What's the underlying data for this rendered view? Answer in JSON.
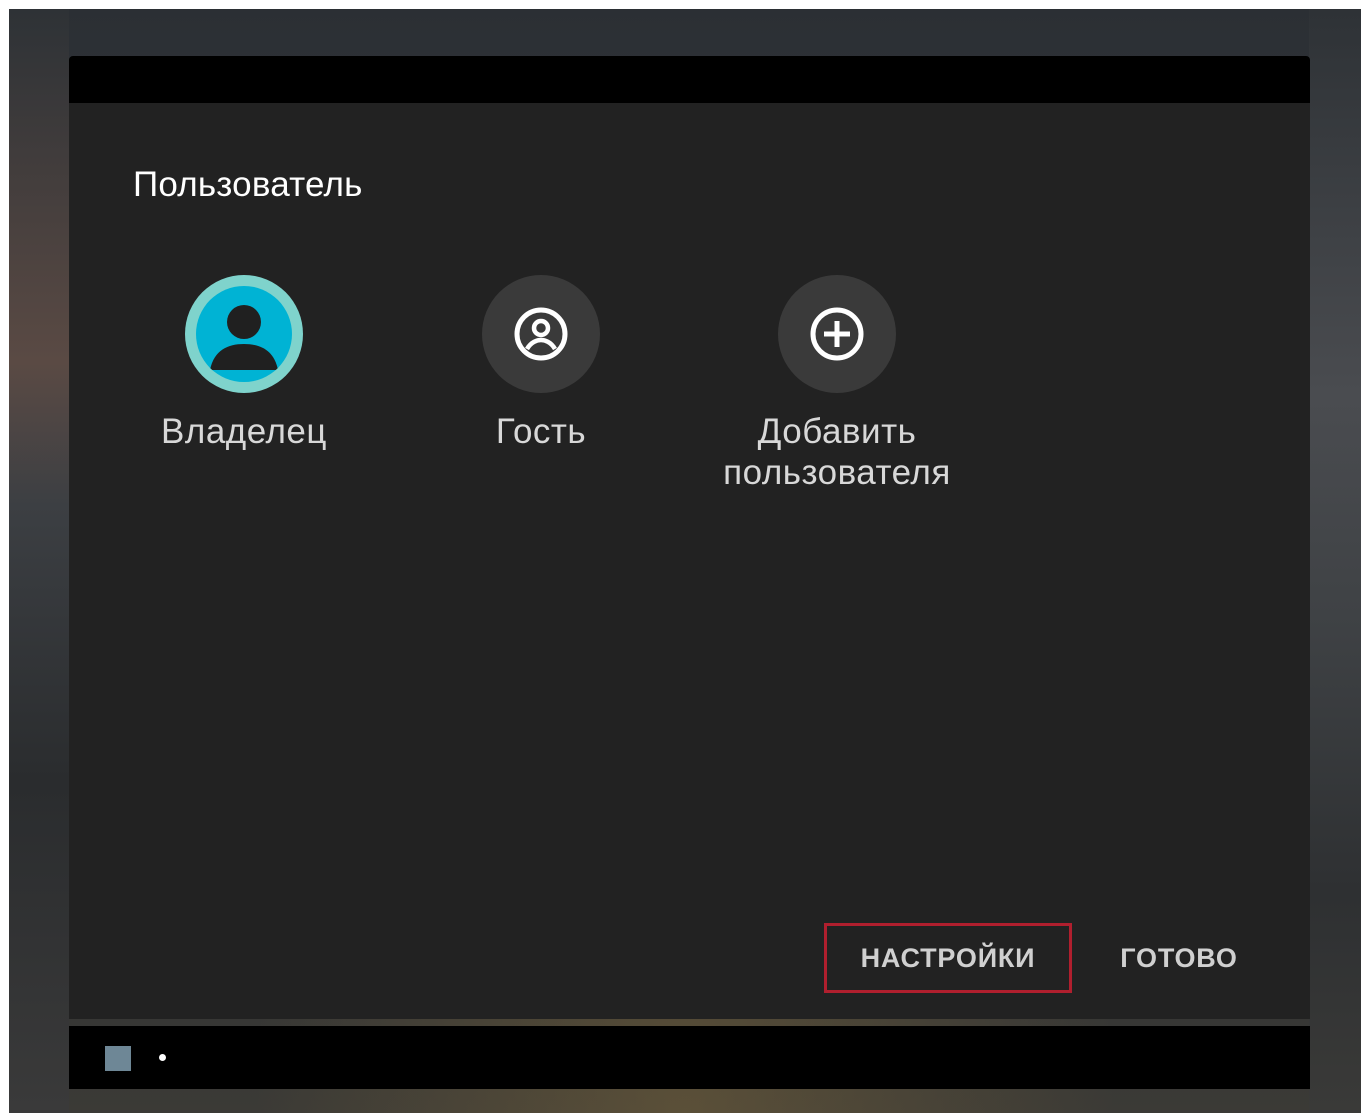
{
  "dialog": {
    "title": "Пользователь"
  },
  "users": [
    {
      "label": "Владелец",
      "icon": "owner-avatar-icon",
      "active": true
    },
    {
      "label": "Гость",
      "icon": "guest-account-icon",
      "active": false
    },
    {
      "label_line1": "Добавить",
      "label_line2": "пользователя",
      "icon": "add-circle-icon",
      "active": false
    }
  ],
  "actions": {
    "settings_label": "НАСТРОЙКИ",
    "done_label": "ГОТОВО"
  },
  "navbar": {
    "icons": [
      "recent-apps-square-icon",
      "notification-dot-icon"
    ]
  },
  "colors": {
    "dialog_background": "#222222",
    "owner_ring": "#7fd3cc",
    "owner_fill": "#00b3d4",
    "highlight_border": "#b01f2e",
    "nav_square": "#6e8796"
  }
}
